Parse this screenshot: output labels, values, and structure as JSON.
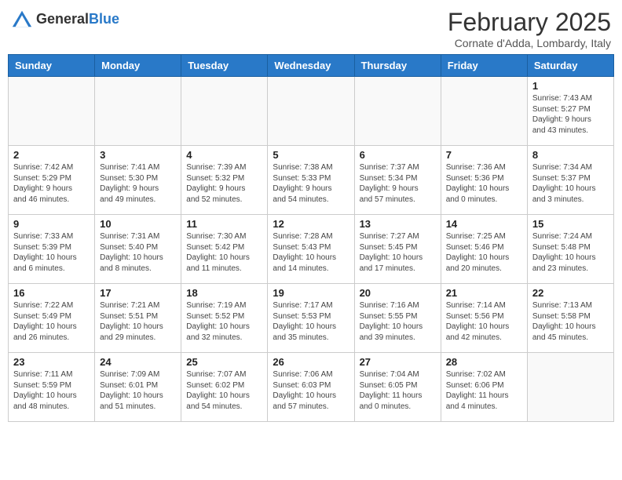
{
  "header": {
    "logo_general": "General",
    "logo_blue": "Blue",
    "month_title": "February 2025",
    "location": "Cornate d'Adda, Lombardy, Italy"
  },
  "weekdays": [
    "Sunday",
    "Monday",
    "Tuesday",
    "Wednesday",
    "Thursday",
    "Friday",
    "Saturday"
  ],
  "weeks": [
    [
      {
        "day": "",
        "info": ""
      },
      {
        "day": "",
        "info": ""
      },
      {
        "day": "",
        "info": ""
      },
      {
        "day": "",
        "info": ""
      },
      {
        "day": "",
        "info": ""
      },
      {
        "day": "",
        "info": ""
      },
      {
        "day": "1",
        "info": "Sunrise: 7:43 AM\nSunset: 5:27 PM\nDaylight: 9 hours\nand 43 minutes."
      }
    ],
    [
      {
        "day": "2",
        "info": "Sunrise: 7:42 AM\nSunset: 5:29 PM\nDaylight: 9 hours\nand 46 minutes."
      },
      {
        "day": "3",
        "info": "Sunrise: 7:41 AM\nSunset: 5:30 PM\nDaylight: 9 hours\nand 49 minutes."
      },
      {
        "day": "4",
        "info": "Sunrise: 7:39 AM\nSunset: 5:32 PM\nDaylight: 9 hours\nand 52 minutes."
      },
      {
        "day": "5",
        "info": "Sunrise: 7:38 AM\nSunset: 5:33 PM\nDaylight: 9 hours\nand 54 minutes."
      },
      {
        "day": "6",
        "info": "Sunrise: 7:37 AM\nSunset: 5:34 PM\nDaylight: 9 hours\nand 57 minutes."
      },
      {
        "day": "7",
        "info": "Sunrise: 7:36 AM\nSunset: 5:36 PM\nDaylight: 10 hours\nand 0 minutes."
      },
      {
        "day": "8",
        "info": "Sunrise: 7:34 AM\nSunset: 5:37 PM\nDaylight: 10 hours\nand 3 minutes."
      }
    ],
    [
      {
        "day": "9",
        "info": "Sunrise: 7:33 AM\nSunset: 5:39 PM\nDaylight: 10 hours\nand 6 minutes."
      },
      {
        "day": "10",
        "info": "Sunrise: 7:31 AM\nSunset: 5:40 PM\nDaylight: 10 hours\nand 8 minutes."
      },
      {
        "day": "11",
        "info": "Sunrise: 7:30 AM\nSunset: 5:42 PM\nDaylight: 10 hours\nand 11 minutes."
      },
      {
        "day": "12",
        "info": "Sunrise: 7:28 AM\nSunset: 5:43 PM\nDaylight: 10 hours\nand 14 minutes."
      },
      {
        "day": "13",
        "info": "Sunrise: 7:27 AM\nSunset: 5:45 PM\nDaylight: 10 hours\nand 17 minutes."
      },
      {
        "day": "14",
        "info": "Sunrise: 7:25 AM\nSunset: 5:46 PM\nDaylight: 10 hours\nand 20 minutes."
      },
      {
        "day": "15",
        "info": "Sunrise: 7:24 AM\nSunset: 5:48 PM\nDaylight: 10 hours\nand 23 minutes."
      }
    ],
    [
      {
        "day": "16",
        "info": "Sunrise: 7:22 AM\nSunset: 5:49 PM\nDaylight: 10 hours\nand 26 minutes."
      },
      {
        "day": "17",
        "info": "Sunrise: 7:21 AM\nSunset: 5:51 PM\nDaylight: 10 hours\nand 29 minutes."
      },
      {
        "day": "18",
        "info": "Sunrise: 7:19 AM\nSunset: 5:52 PM\nDaylight: 10 hours\nand 32 minutes."
      },
      {
        "day": "19",
        "info": "Sunrise: 7:17 AM\nSunset: 5:53 PM\nDaylight: 10 hours\nand 35 minutes."
      },
      {
        "day": "20",
        "info": "Sunrise: 7:16 AM\nSunset: 5:55 PM\nDaylight: 10 hours\nand 39 minutes."
      },
      {
        "day": "21",
        "info": "Sunrise: 7:14 AM\nSunset: 5:56 PM\nDaylight: 10 hours\nand 42 minutes."
      },
      {
        "day": "22",
        "info": "Sunrise: 7:13 AM\nSunset: 5:58 PM\nDaylight: 10 hours\nand 45 minutes."
      }
    ],
    [
      {
        "day": "23",
        "info": "Sunrise: 7:11 AM\nSunset: 5:59 PM\nDaylight: 10 hours\nand 48 minutes."
      },
      {
        "day": "24",
        "info": "Sunrise: 7:09 AM\nSunset: 6:01 PM\nDaylight: 10 hours\nand 51 minutes."
      },
      {
        "day": "25",
        "info": "Sunrise: 7:07 AM\nSunset: 6:02 PM\nDaylight: 10 hours\nand 54 minutes."
      },
      {
        "day": "26",
        "info": "Sunrise: 7:06 AM\nSunset: 6:03 PM\nDaylight: 10 hours\nand 57 minutes."
      },
      {
        "day": "27",
        "info": "Sunrise: 7:04 AM\nSunset: 6:05 PM\nDaylight: 11 hours\nand 0 minutes."
      },
      {
        "day": "28",
        "info": "Sunrise: 7:02 AM\nSunset: 6:06 PM\nDaylight: 11 hours\nand 4 minutes."
      },
      {
        "day": "",
        "info": ""
      }
    ]
  ]
}
